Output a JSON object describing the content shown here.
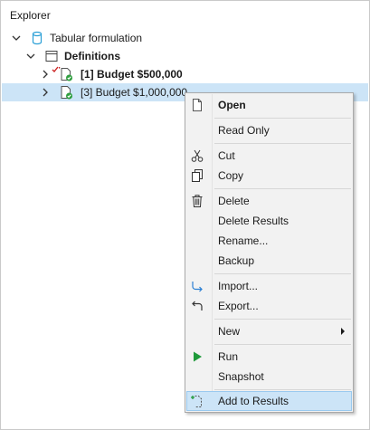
{
  "panel": {
    "title": "Explorer"
  },
  "tree": {
    "root": {
      "label": "Tabular formulation"
    },
    "definitions": {
      "label": "Definitions"
    },
    "items": [
      {
        "label": "[1] Budget $500,000"
      },
      {
        "label": "[3] Budget $1,000,000"
      }
    ]
  },
  "menu": {
    "items": {
      "open": "Open",
      "read_only": "Read Only",
      "cut": "Cut",
      "copy": "Copy",
      "delete": "Delete",
      "delete_results": "Delete Results",
      "rename": "Rename...",
      "backup": "Backup",
      "import": "Import...",
      "export": "Export...",
      "new": "New",
      "run": "Run",
      "snapshot": "Snapshot",
      "add_to_results": "Add to Results"
    }
  },
  "colors": {
    "selection": "#cce4f7",
    "db_icon": "#2a9fd6",
    "check_green": "#2e9e3e",
    "run_green": "#1f9a3a",
    "check_red": "#cc2222"
  }
}
